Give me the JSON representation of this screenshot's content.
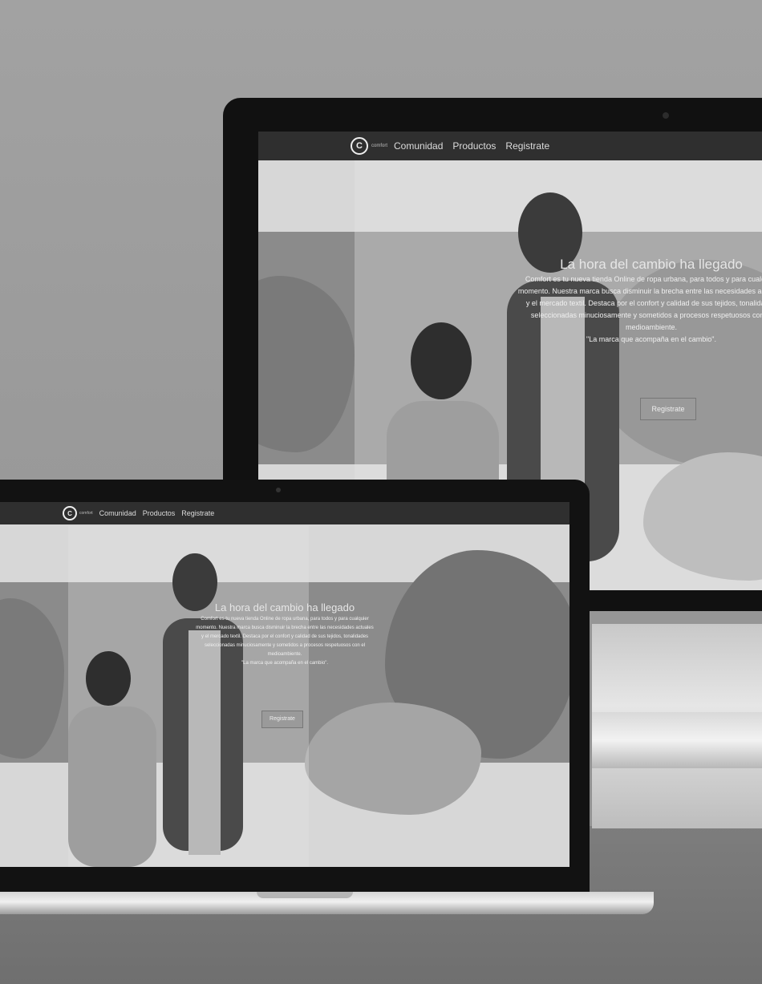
{
  "site": {
    "brand": "comfort",
    "logo_letter": "C",
    "nav": [
      "Comunidad",
      "Productos",
      "Registrate"
    ],
    "hero_title": "La hora del cambio ha llegado",
    "hero_body": [
      "Comfort es tu nueva tienda Online de ropa urbana, para todos y para cualquier",
      "momento. Nuestra marca busca disminuir la brecha entre las necesidades actuales",
      "y el mercado textil. Destaca por el confort y calidad de sus tejidos, tonalidades",
      "seleccionadas minuciosamente y sometidos a procesos respetuosos con el",
      "medioambiente."
    ],
    "tagline": "\"La marca que acompaña en el cambio\".",
    "cta": "Registrate"
  },
  "colors": {
    "nav": "#2f2f2f",
    "band": "#8b8b8b",
    "background": "#d7d7d7"
  }
}
